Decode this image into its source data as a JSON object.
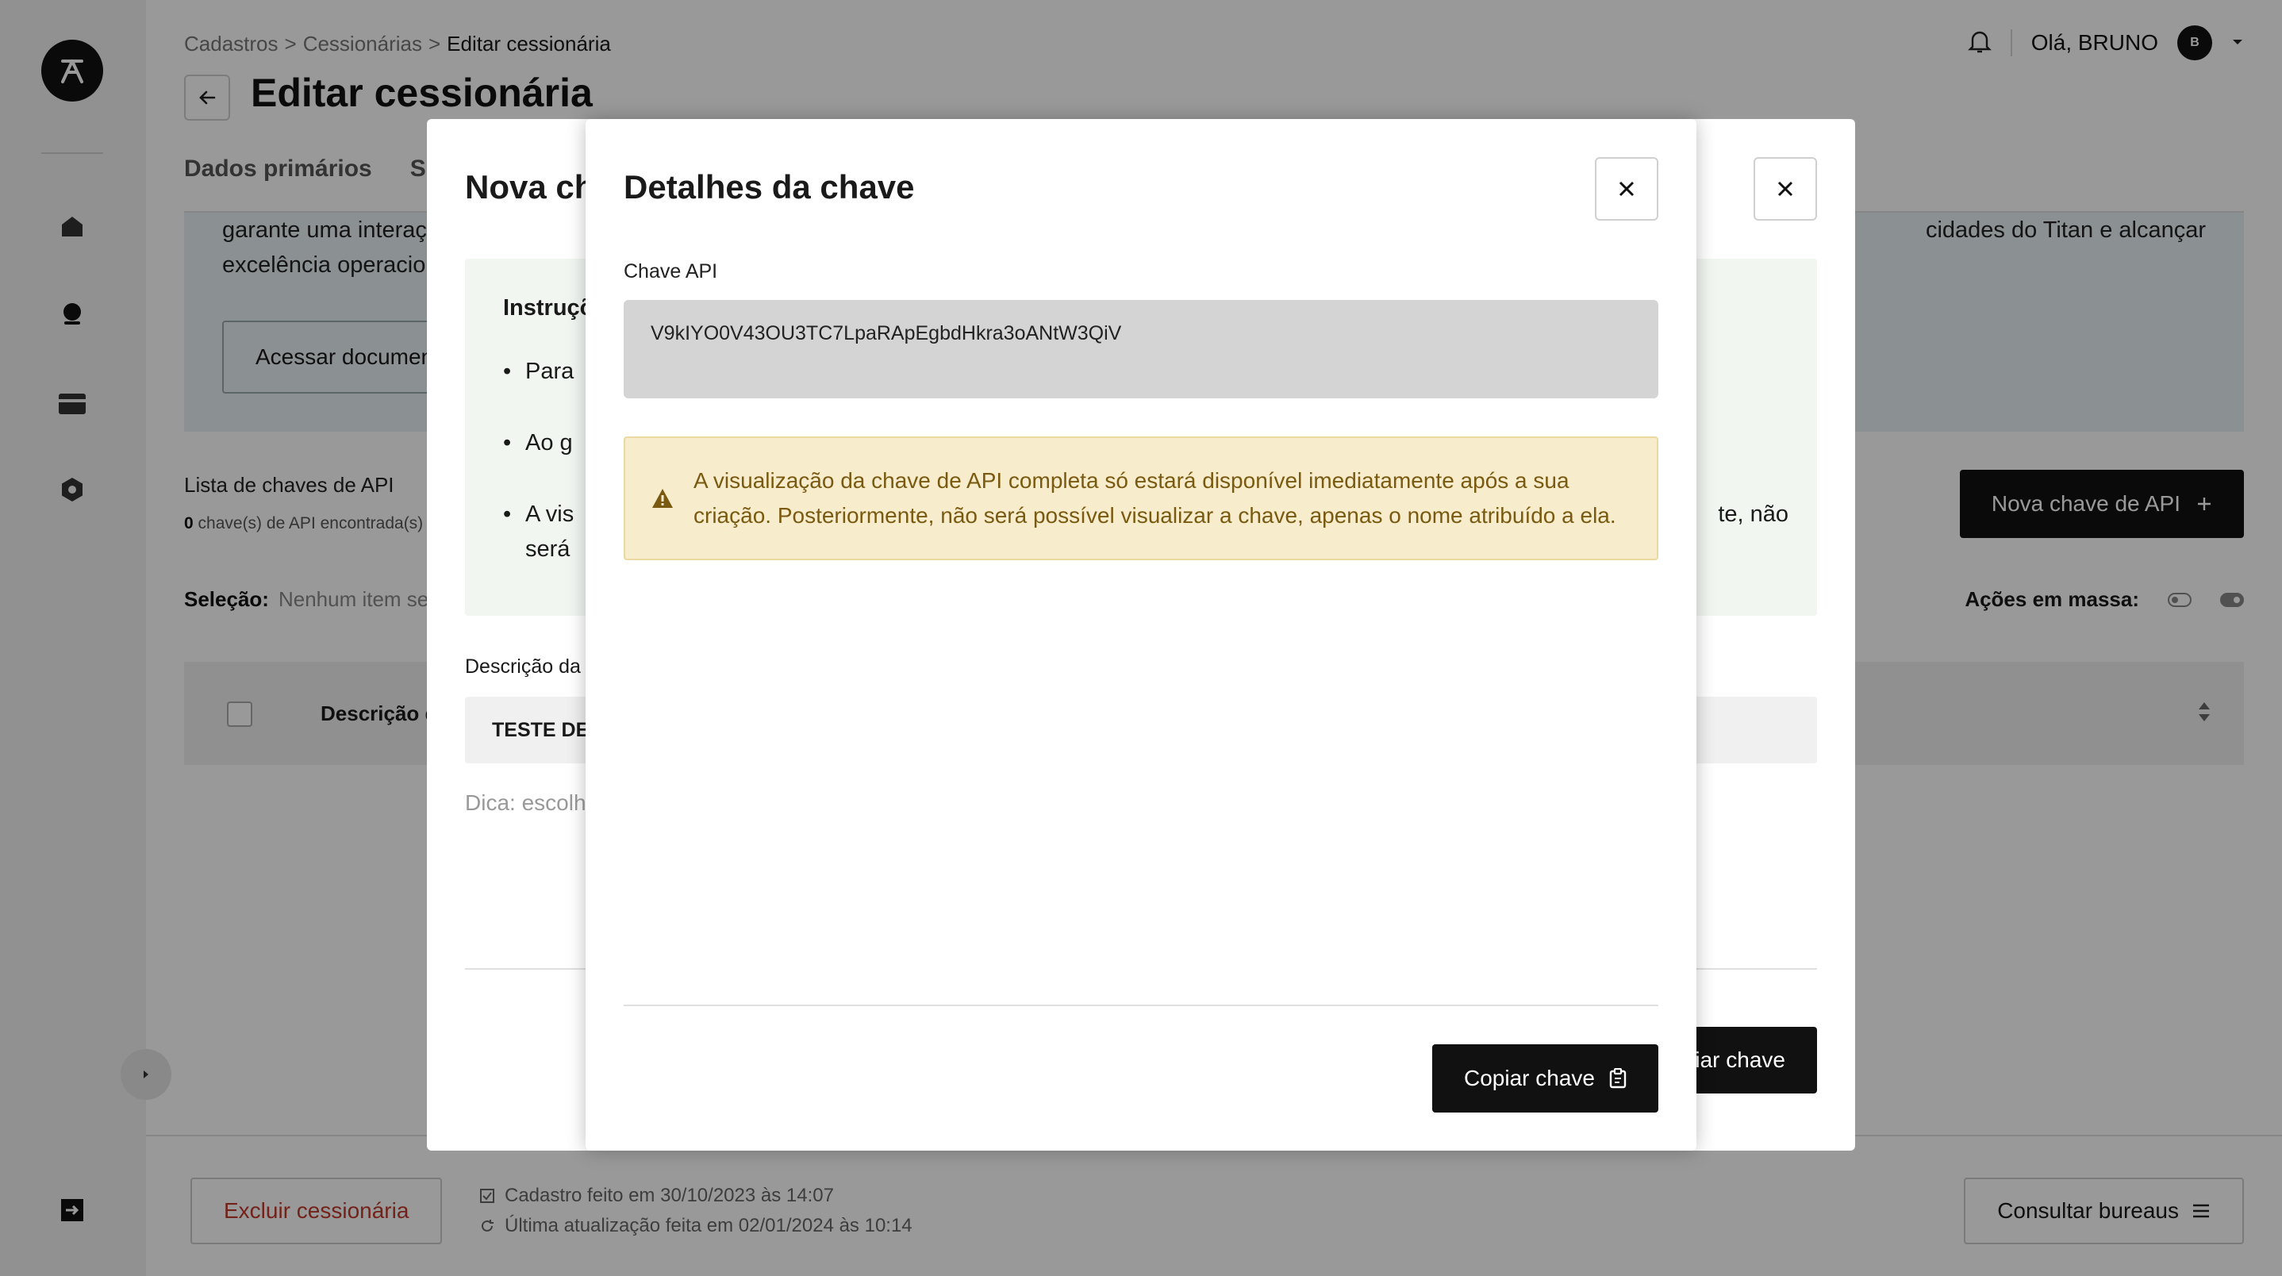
{
  "breadcrumb": {
    "items": [
      "Cadastros",
      "Cessionárias",
      "Editar cessionária"
    ],
    "sep": ">"
  },
  "page": {
    "title": "Editar cessionária"
  },
  "header": {
    "greeting": "Olá, BRUNO",
    "avatar_initial": "B"
  },
  "tabs": [
    "Dados primários",
    "Só"
  ],
  "info": {
    "line1_left": "garante uma interaç",
    "line1_right": "cidades do Titan e alcançar",
    "line2_left": "excelência operacio",
    "doc_button": "Acessar documen"
  },
  "api_list": {
    "title": "Lista de chaves de API",
    "count": "0",
    "count_suffix": "chave(s) de API encontrada(s)",
    "new_button": "Nova chave de API"
  },
  "selection": {
    "label": "Seleção:",
    "value": "Nenhum item sele",
    "bulk_label": "Ações em massa:"
  },
  "table": {
    "col_description": "Descrição d"
  },
  "footer": {
    "delete_button": "Excluir cessionária",
    "created": "Cadastro feito em 30/10/2023 às 14:07",
    "updated": "Última atualização feita em 02/01/2024 às 10:14",
    "bureau_button": "Consultar bureaus"
  },
  "modal_new": {
    "title": "Nova ch",
    "instructions_title": "Instruçõ",
    "bullet1": "Para",
    "bullet2": "Ao g",
    "bullet3": "A vis",
    "bullet3_tail": "te, não",
    "bullet3_line2": "será",
    "desc_label": "Descrição da",
    "desc_value": "TESTE DE",
    "hint": "Dica: escolh",
    "button": "iar chave"
  },
  "modal_details": {
    "title": "Detalhes da chave",
    "key_label": "Chave API",
    "key_value": "V9kIYO0V43OU3TC7LpaRApEgbdHkra3oANtW3QiV",
    "warning_line1": "A visualização da chave de API completa só estará disponível imediatamente após a sua",
    "warning_line2": "criação. Posteriormente, não será possível visualizar a chave, apenas o nome atribuído a ela.",
    "copy_button": "Copiar chave"
  },
  "colors": {
    "warning_bg": "#f7eccc",
    "warning_text": "#7a5a10",
    "primary": "#111111",
    "danger": "#c0392b"
  }
}
